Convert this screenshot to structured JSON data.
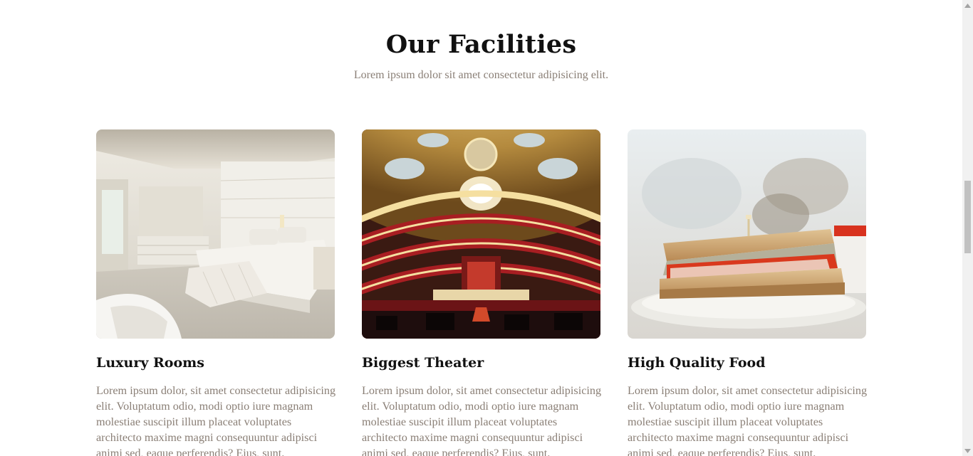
{
  "section": {
    "title": "Our Facilities",
    "subtitle": "Lorem ipsum dolor sit amet consectetur adipisicing elit."
  },
  "cards": [
    {
      "title": "Luxury Rooms",
      "text": "Lorem ipsum dolor, sit amet consectetur adipisicing elit. Voluptatum odio, modi optio iure magnam molestiae suscipit illum placeat voluptates architecto maxime magni consequuntur adipisci animi sed, eaque perferendis? Eius, sunt.",
      "image": "luxury-bedroom-photo"
    },
    {
      "title": "Biggest Theater",
      "text": "Lorem ipsum dolor, sit amet consectetur adipisicing elit. Voluptatum odio, modi optio iure magnam molestiae suscipit illum placeat voluptates architecto maxime magni consequuntur adipisci animi sed, eaque perferendis? Eius, sunt.",
      "image": "opera-theater-photo"
    },
    {
      "title": "High Quality Food",
      "text": "Lorem ipsum dolor, sit amet consectetur adipisicing elit. Voluptatum odio, modi optio iure magnam molestiae suscipit illum placeat voluptates architecto maxime magni consequuntur adipisci animi sed, eaque perferendis? Eius, sunt.",
      "image": "sandwich-photo"
    }
  ],
  "scrollbar": {
    "position_fraction": 0.47
  },
  "colors": {
    "heading": "#111111",
    "body_text": "#8a7f76",
    "background": "#ffffff"
  }
}
